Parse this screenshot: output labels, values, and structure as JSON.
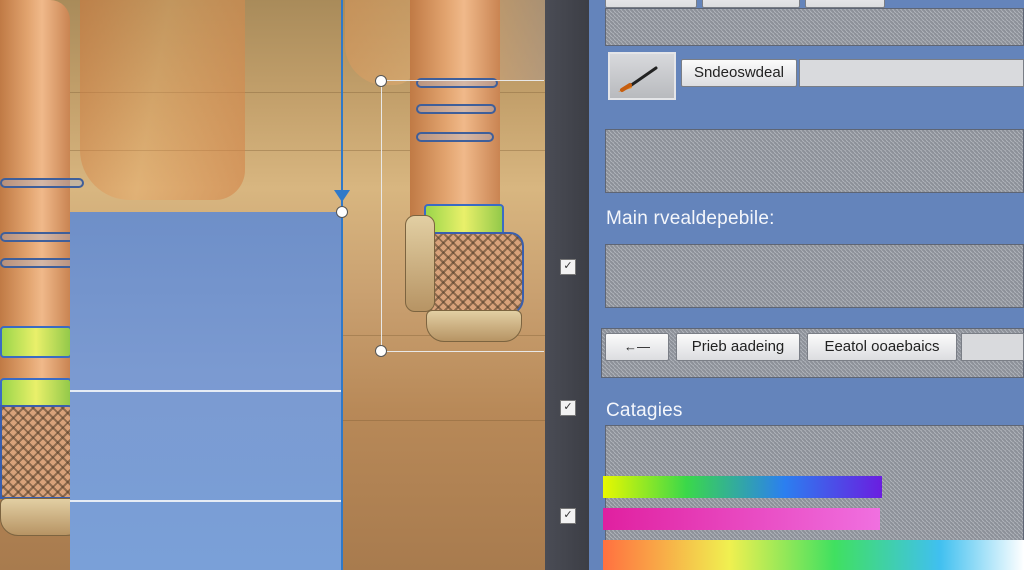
{
  "toolbar": {
    "swatch_label": "Sndeoswdeal"
  },
  "section_main": {
    "heading": "Main rvealdepebile:"
  },
  "actions": {
    "arrow_label": "←—",
    "button1_label": "Prieb aadeing",
    "button2_label": "Eeatol ooaebaics"
  },
  "section_categories": {
    "heading": "Catagies"
  },
  "gutter": {
    "check_glyph": "✓"
  },
  "colors": {
    "panel_bg": "#6484bb",
    "accent": "#2f79c9",
    "gradient_rainbow": [
      "#e8f800",
      "#3ad84a",
      "#2b7ff0",
      "#6a1ee0"
    ],
    "gradient_magenta": [
      "#e020a0",
      "#f070e0"
    ],
    "gradient_spectrum": [
      "#ff7040",
      "#f0f050",
      "#40e060",
      "#40c0f0",
      "#ffffff"
    ]
  },
  "icons": {
    "brush": "paintbrush-icon"
  }
}
